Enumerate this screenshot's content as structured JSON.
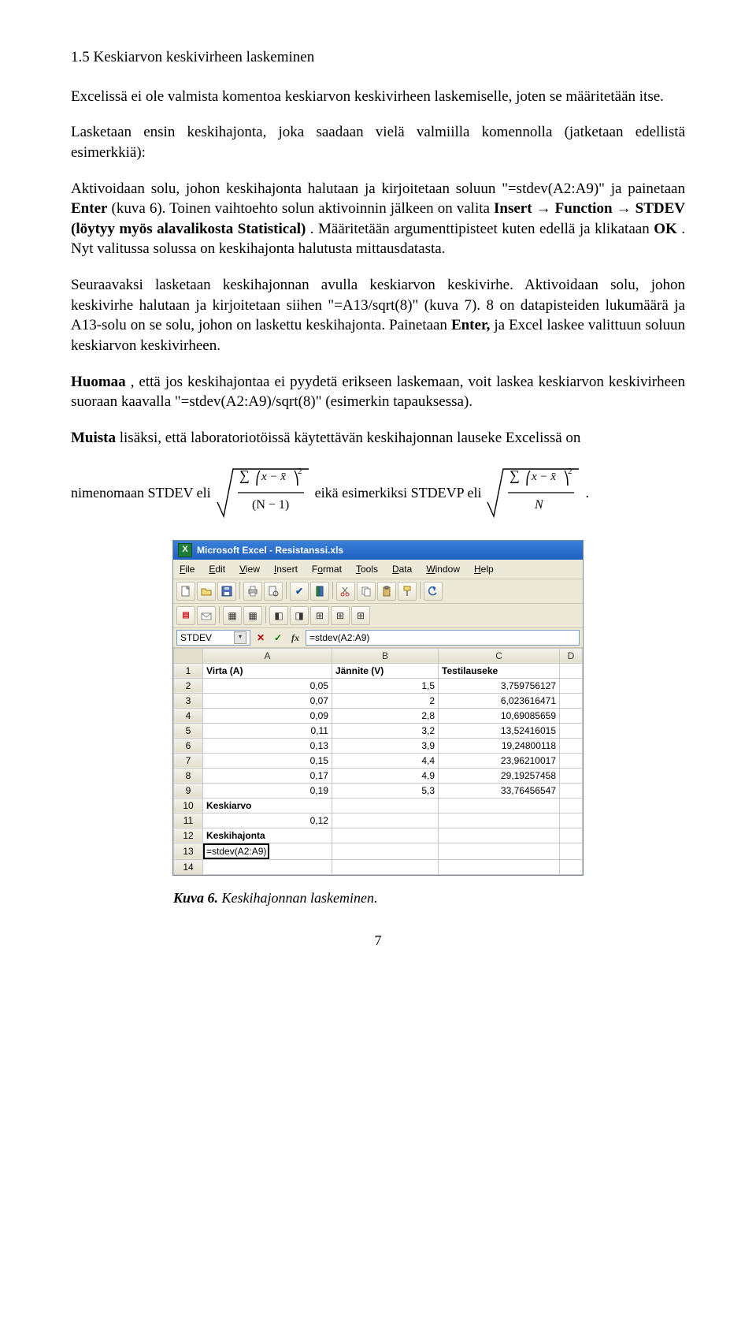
{
  "heading": "1.5 Keskiarvon keskivirheen laskeminen",
  "p1": "Excelissä ei ole valmista komentoa keskiarvon keskivirheen laskemiselle, joten se määritetään itse.",
  "p2a": "Lasketaan ensin keskihajonta, joka saadaan vielä valmiilla komennolla (jatketaan edellistä esimerkkiä):",
  "p2b_pre": "Aktivoidaan solu, johon keskihajonta halutaan ja kirjoitetaan soluun \"=stdev(A2:A9)\" ja painetaan ",
  "p2b_enter": "Enter",
  "p2b_post": " (kuva 6). Toinen vaihtoehto solun aktivoinnin jälkeen on valita ",
  "p2b_ins": "Insert → Function → STDEV (löytyy myös alavalikosta Statistical)",
  "p2b_after_ins": ". Määritetään argumenttipisteet kuten edellä ja klikataan ",
  "p2b_ok": "OK",
  "p2b_rest": ". Nyt valitussa solussa on keskihajonta halutusta mittausdatasta.",
  "p3_pre": "Seuraavaksi lasketaan keskihajonnan avulla keskiarvon keskivirhe. Aktivoidaan solu, johon keskivirhe halutaan ja kirjoitetaan siihen \"=A13/sqrt(8)\" (kuva 7). 8 on datapisteiden lukumäärä ja A13-solu on se solu, johon on laskettu keskihajonta. Painetaan ",
  "p3_enter": "Enter, ",
  "p3_post": "ja Excel laskee valittuun soluun keskiarvon keskivirheen.",
  "p4_pre": "Huomaa",
  "p4_rest": ", että jos keskihajontaa ei pyydetä erikseen laskemaan, voit laskea keskiarvon keskivirheen suoraan kaavalla \"=stdev(A2:A9)/sqrt(8)\" (esimerkin tapauksessa).",
  "p5_pre": "Muista",
  "p5_rest": " lisäksi, että laboratoriotöissä käytettävän keskihajonnan lauseke Excelissä on",
  "formula": {
    "lead": "nimenomaan STDEV eli",
    "mid": "eikä esimerkiksi STDEVP eli",
    "end": "."
  },
  "excel": {
    "title": "Microsoft Excel - Resistanssi.xls",
    "menus": [
      "File",
      "Edit",
      "View",
      "Insert",
      "Format",
      "Tools",
      "Data",
      "Window",
      "Help"
    ],
    "namebox": "STDEV",
    "fx_label": "fx",
    "formula_input": "=stdev(A2:A9)",
    "col_headers": [
      "A",
      "B",
      "C",
      "D"
    ],
    "rows": [
      {
        "n": "1",
        "a": "Virta (A)",
        "b": "Jännite (V)",
        "c": "Testilauseke",
        "d": "",
        "bold": true
      },
      {
        "n": "2",
        "a": "0,05",
        "b": "1,5",
        "c": "3,759756127",
        "d": ""
      },
      {
        "n": "3",
        "a": "0,07",
        "b": "2",
        "c": "6,023616471",
        "d": ""
      },
      {
        "n": "4",
        "a": "0,09",
        "b": "2,8",
        "c": "10,69085659",
        "d": ""
      },
      {
        "n": "5",
        "a": "0,11",
        "b": "3,2",
        "c": "13,52416015",
        "d": ""
      },
      {
        "n": "6",
        "a": "0,13",
        "b": "3,9",
        "c": "19,24800118",
        "d": ""
      },
      {
        "n": "7",
        "a": "0,15",
        "b": "4,4",
        "c": "23,96210017",
        "d": ""
      },
      {
        "n": "8",
        "a": "0,17",
        "b": "4,9",
        "c": "29,19257458",
        "d": ""
      },
      {
        "n": "9",
        "a": "0,19",
        "b": "5,3",
        "c": "33,76456547",
        "d": ""
      },
      {
        "n": "10",
        "a": "Keskiarvo",
        "b": "",
        "c": "",
        "d": "",
        "bold": true
      },
      {
        "n": "11",
        "a": "0,12",
        "b": "",
        "c": "",
        "d": ""
      },
      {
        "n": "12",
        "a": "Keskihajonta",
        "b": "",
        "c": "",
        "d": "",
        "bold": true
      }
    ],
    "editing_row": {
      "n": "13",
      "value": "=stdev(A2:A9)"
    },
    "trailing_row": "14"
  },
  "caption_bold": "Kuva 6.",
  "caption_rest": " Keskihajonnan laskeminen.",
  "page_number": "7"
}
